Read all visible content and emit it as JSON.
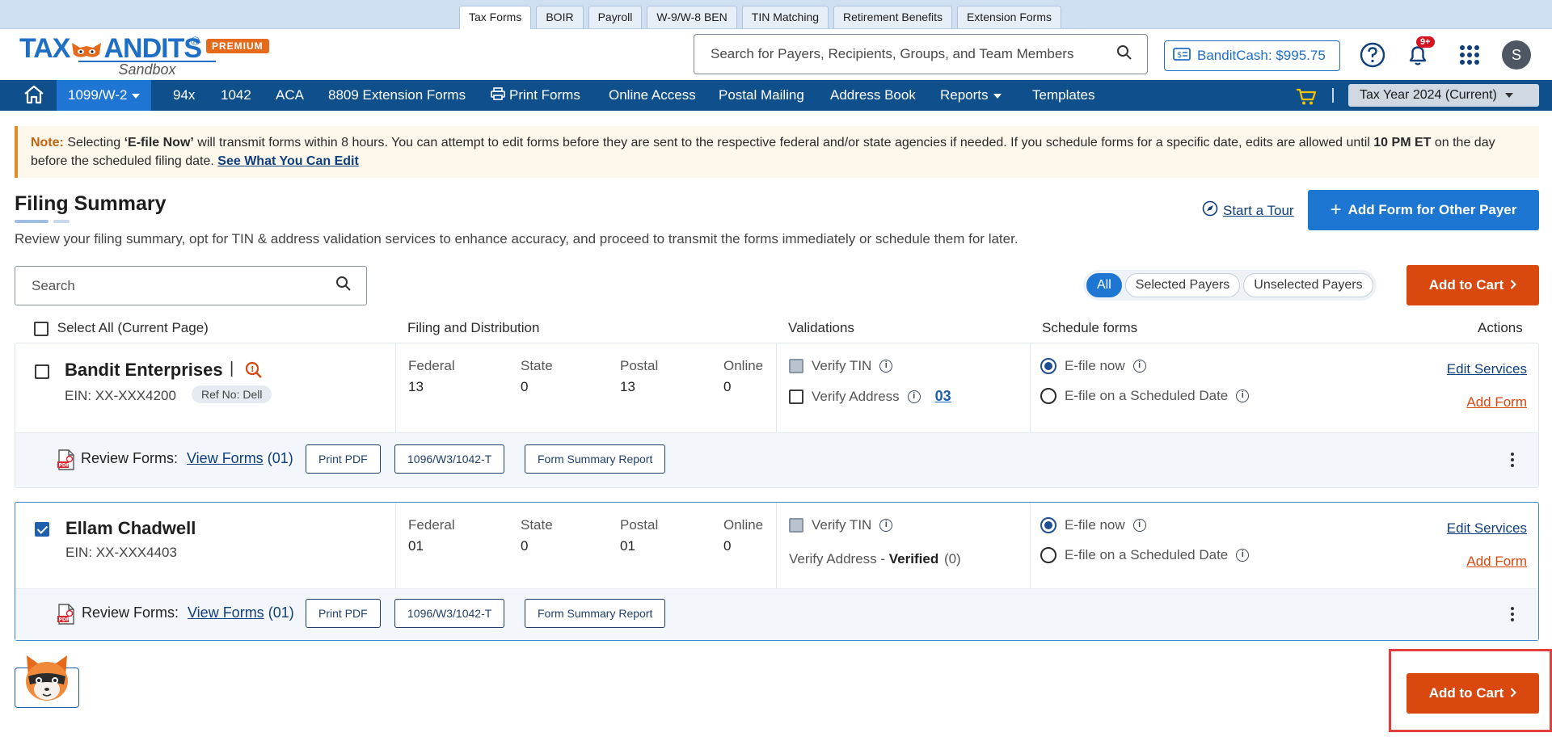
{
  "product_tabs": [
    "Tax Forms",
    "BOIR",
    "Payroll",
    "W-9/W-8 BEN",
    "TIN Matching",
    "Retirement Benefits",
    "Extension Forms"
  ],
  "brand": {
    "logo_tax": "TAX",
    "logo_andits": "ANDITS",
    "logo_reg": "®",
    "badge": "PREMIUM",
    "sub": "Sandbox"
  },
  "header": {
    "search_placeholder": "Search for Payers, Recipients, Groups, and Team Members",
    "bandit_cash": "BanditCash: $995.75",
    "notification_count": "9+",
    "avatar_initial": "S"
  },
  "nav": {
    "active_item": "1099/W-2",
    "items": [
      "94x",
      "1042",
      "ACA",
      "8809 Extension Forms",
      "Print Forms",
      "Online Access",
      "Postal Mailing",
      "Address Book",
      "Reports",
      "Templates"
    ],
    "tax_year": "Tax Year 2024 (Current)"
  },
  "note": {
    "label": "Note:",
    "text_1": " Selecting ",
    "bold_1": "‘E-file Now’",
    "text_2": " will transmit forms within 8 hours. You can attempt to edit forms before they are sent to the respective federal and/or state agencies if needed. If you schedule forms for a specific date, edits are allowed until ",
    "bold_2": "10 PM ET",
    "text_3": " on the day before the scheduled filing date. ",
    "link": "See What You Can Edit"
  },
  "page": {
    "title": "Filing Summary",
    "subtitle": "Review your filing summary, opt for TIN & address validation services to enhance accuracy, and proceed to transmit the forms immediately or schedule them for later.",
    "start_tour": "Start a Tour",
    "add_form_other_payer": "Add Form for Other Payer",
    "search_placeholder": "Search",
    "filters": [
      "All",
      "Selected Payers",
      "Unselected Payers"
    ],
    "active_filter": "All",
    "add_to_cart": "Add to Cart"
  },
  "table_headers": {
    "select_all": "Select All (Current Page)",
    "filing": "Filing and Distribution",
    "validations": "Validations",
    "schedule": "Schedule forms",
    "actions": "Actions"
  },
  "labels": {
    "federal": "Federal",
    "state": "State",
    "postal": "Postal",
    "online": "Online",
    "verify_tin": "Verify TIN",
    "verify_address": "Verify Address",
    "efile_now": "E-file now",
    "efile_scheduled": "E-file on a Scheduled Date",
    "edit_services": "Edit Services",
    "add_form": "Add Form",
    "review_forms": "Review Forms:",
    "view_forms": "View Forms",
    "print_pdf": "Print PDF",
    "transmittal": "1096/W3/1042-T",
    "summary_report": "Form Summary Report"
  },
  "payers": [
    {
      "name": "Bandit Enterprises",
      "ein": "EIN: XX-XXX4200",
      "ref": "Ref No: Dell",
      "selected": false,
      "federal": "13",
      "state": "0",
      "postal": "13",
      "online": "0",
      "address_count": "03",
      "view_forms_count": "(01)"
    },
    {
      "name": "Ellam Chadwell",
      "ein": "EIN: XX-XXX4403",
      "selected": true,
      "federal": "01",
      "state": "0",
      "postal": "01",
      "online": "0",
      "verify_address_status_prefix": "Verify Address",
      "verify_address_status_sep": " - ",
      "verify_address_status": "Verified",
      "verify_address_status_count": "(0)",
      "view_forms_count": "(01)"
    }
  ],
  "colors": {
    "nav_bg": "#0f4f8c",
    "primary": "#1c76d2",
    "cart": "#d9480f",
    "brand_orange": "#e56a1c"
  }
}
